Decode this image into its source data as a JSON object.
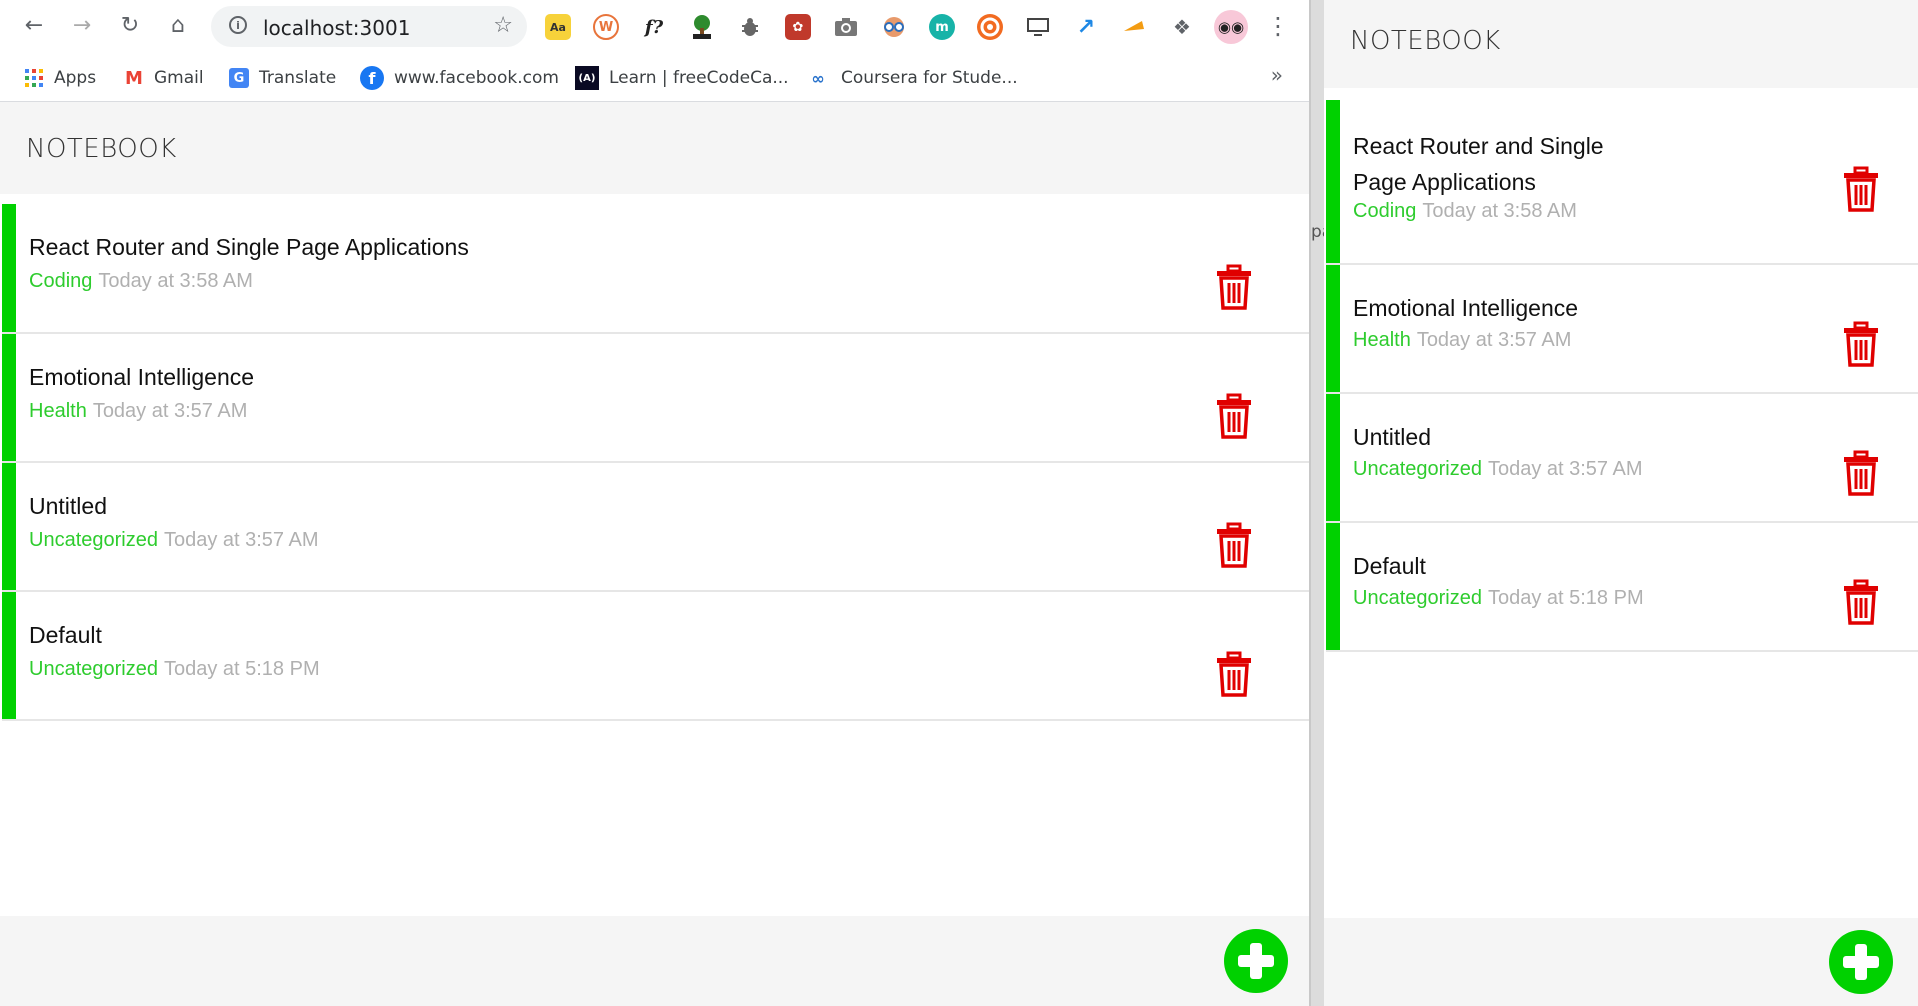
{
  "browser": {
    "url": "localhost:3001",
    "bookmarks": [
      {
        "label": "Apps",
        "icon": "apps-grid-icon"
      },
      {
        "label": "Gmail",
        "icon": "gmail-icon"
      },
      {
        "label": "Translate",
        "icon": "translate-icon"
      },
      {
        "label": "www.facebook.com",
        "icon": "facebook-icon"
      },
      {
        "label": "Learn | freeCodeCa...",
        "icon": "freecodecamp-icon"
      },
      {
        "label": "Coursera for Stude...",
        "icon": "coursera-icon"
      }
    ],
    "more_bookmarks": "»",
    "extensions": [
      "dictionary-ext-icon",
      "wordpress-ext-icon",
      "formula-ext-icon",
      "html-tree-ext-icon",
      "bug-ext-icon",
      "leaf-ext-icon",
      "camera-ext-icon",
      "glasses-ext-icon",
      "m-ext-icon",
      "lifebuoy-ext-icon",
      "cast-ext-icon",
      "expand-ext-icon",
      "swipe-ext-icon",
      "puzzle-ext-icon"
    ]
  },
  "app": {
    "title": "NOTEBOOK",
    "notes": [
      {
        "title": "React Router and Single Page Applications",
        "category": "Coding",
        "time": "Today at 3:58 AM"
      },
      {
        "title": "Emotional Intelligence",
        "category": "Health",
        "time": "Today at 3:57 AM"
      },
      {
        "title": "Untitled",
        "category": "Uncategorized",
        "time": "Today at 3:57 AM"
      },
      {
        "title": "Default",
        "category": "Uncategorized",
        "time": "Today at 5:18 PM"
      }
    ],
    "mobile_title_lines": [
      [
        "React Router and Single",
        "Page Applications"
      ]
    ],
    "peek_text": "pa"
  },
  "colors": {
    "accent_green": "#00d100",
    "category_green": "#2ecc2e",
    "trash_red": "#e00000",
    "timestamp_gray": "#b0b0b0"
  }
}
